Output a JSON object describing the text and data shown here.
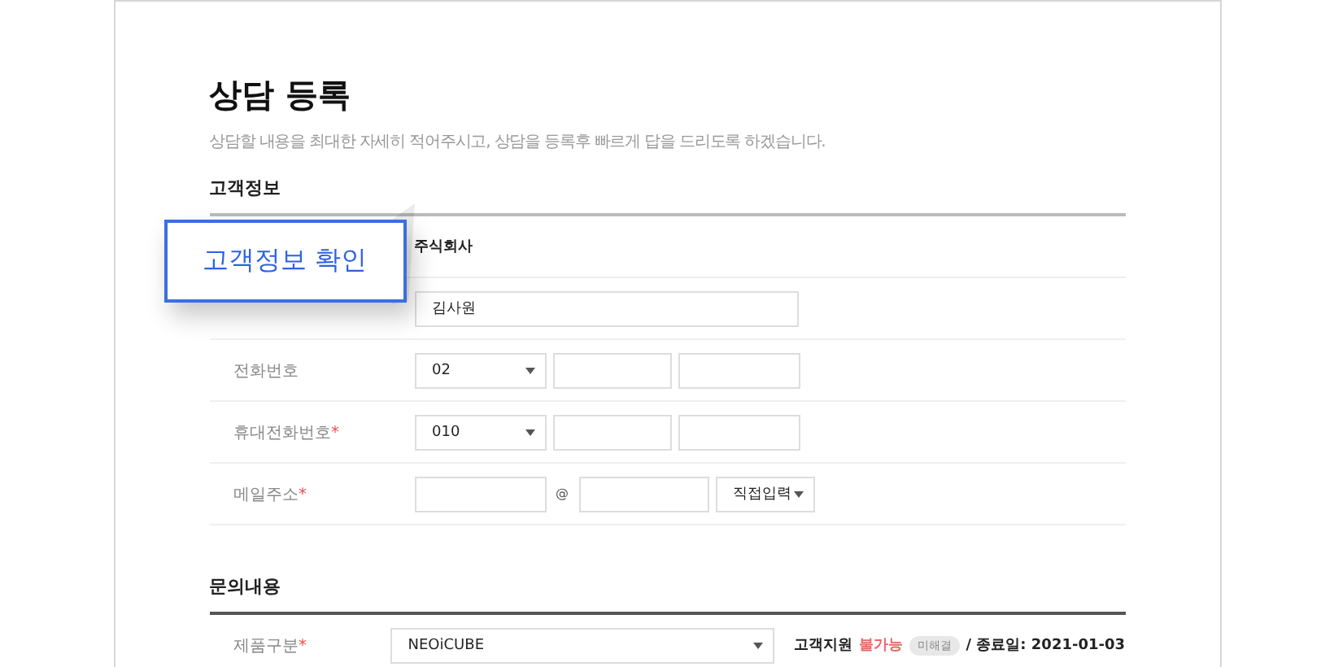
{
  "title": "상담 등록",
  "subtitle": "상담할 내용을  최대한 자세히 적어주시고, 상담을 등록후 빠르게 답을 드리도록 하겠습니다.",
  "callout": "고객정보 확인",
  "sections": [
    {
      "heading": "고객정보",
      "rows": [
        {
          "kind": "text",
          "value": "주식회사"
        },
        {
          "kind": "input",
          "value": "김사원"
        },
        {
          "kind": "phone",
          "label": "전화번호",
          "select": "02"
        },
        {
          "kind": "phone",
          "label": "휴대전화번호",
          "required_mark": "*",
          "select": "010"
        },
        {
          "kind": "email",
          "label": "메일주소",
          "required_mark": "*",
          "at": "@",
          "select": "직접입력"
        }
      ]
    },
    {
      "heading": "문의내용",
      "rows": [
        {
          "kind": "product",
          "label": "제품구분",
          "required_mark": "*",
          "select": "NEOiCUBE",
          "support": "고객지원",
          "support_state": "불가능",
          "badge": "미해결",
          "end_date": "/ 종료일: 2021-01-03"
        }
      ]
    }
  ]
}
